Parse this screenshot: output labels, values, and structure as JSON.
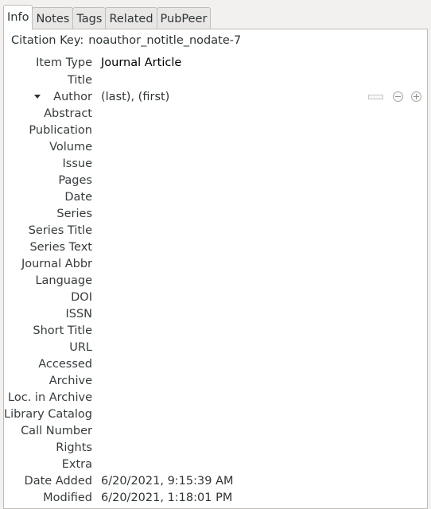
{
  "tabs": [
    {
      "label": "Info",
      "active": true
    },
    {
      "label": "Notes",
      "active": false
    },
    {
      "label": "Tags",
      "active": false
    },
    {
      "label": "Related",
      "active": false
    },
    {
      "label": "PubPeer",
      "active": false
    }
  ],
  "citation": {
    "label": "Citation Key:",
    "value": "noauthor_notitle_nodate-7"
  },
  "fields": {
    "item_type": {
      "label": "Item Type",
      "value": "Journal Article"
    },
    "title": {
      "label": "Title",
      "value": ""
    },
    "author": {
      "label": "Author",
      "value": "(last), (first)"
    },
    "abstract": {
      "label": "Abstract",
      "value": ""
    },
    "publication": {
      "label": "Publication",
      "value": ""
    },
    "volume": {
      "label": "Volume",
      "value": ""
    },
    "issue": {
      "label": "Issue",
      "value": ""
    },
    "pages": {
      "label": "Pages",
      "value": ""
    },
    "date": {
      "label": "Date",
      "value": ""
    },
    "series": {
      "label": "Series",
      "value": ""
    },
    "series_title": {
      "label": "Series Title",
      "value": ""
    },
    "series_text": {
      "label": "Series Text",
      "value": ""
    },
    "journal_abbr": {
      "label": "Journal Abbr",
      "value": ""
    },
    "language": {
      "label": "Language",
      "value": ""
    },
    "doi": {
      "label": "DOI",
      "value": ""
    },
    "issn": {
      "label": "ISSN",
      "value": ""
    },
    "short_title": {
      "label": "Short Title",
      "value": ""
    },
    "url": {
      "label": "URL",
      "value": ""
    },
    "accessed": {
      "label": "Accessed",
      "value": ""
    },
    "archive": {
      "label": "Archive",
      "value": ""
    },
    "loc_in_archive": {
      "label": "Loc. in Archive",
      "value": ""
    },
    "library_catalog": {
      "label": "Library Catalog",
      "value": ""
    },
    "call_number": {
      "label": "Call Number",
      "value": ""
    },
    "rights": {
      "label": "Rights",
      "value": ""
    },
    "extra": {
      "label": "Extra",
      "value": ""
    },
    "date_added": {
      "label": "Date Added",
      "value": "6/20/2021, 9:15:39 AM"
    },
    "modified": {
      "label": "Modified",
      "value": "6/20/2021, 1:18:01 PM"
    }
  },
  "author_controls": {
    "expand_icon": "triangle-down-icon",
    "switch_icon": "field-mode-switch-icon",
    "remove_icon": "minus-circle-icon",
    "add_icon": "plus-circle-icon"
  }
}
